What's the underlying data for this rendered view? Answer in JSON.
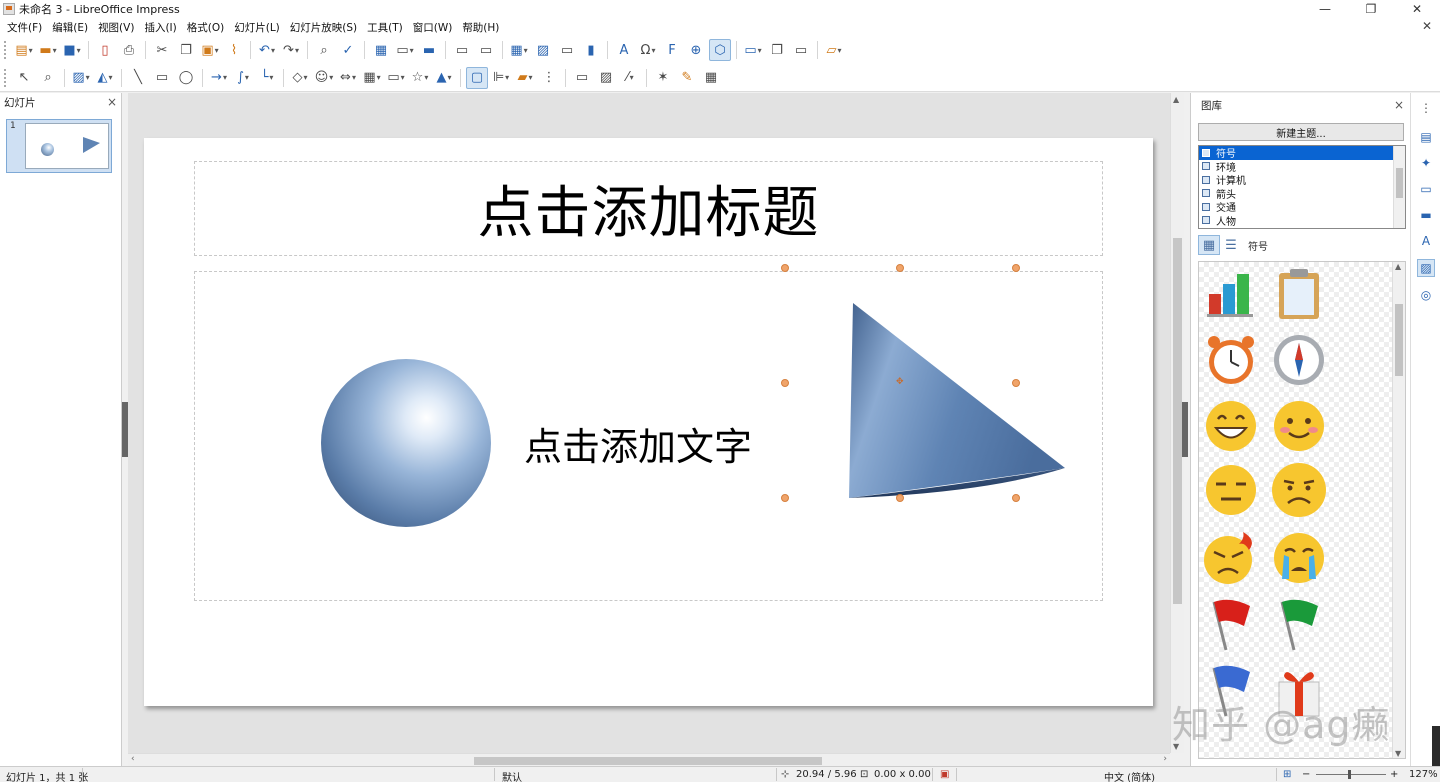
{
  "window": {
    "title": "未命名 3 - LibreOffice Impress",
    "minimize": "—",
    "restore": "❐",
    "close": "✕"
  },
  "menu": [
    "文件(F)",
    "编辑(E)",
    "视图(V)",
    "插入(I)",
    "格式(O)",
    "幻灯片(L)",
    "幻灯片放映(S)",
    "工具(T)",
    "窗口(W)",
    "帮助(H)"
  ],
  "slide_pane": {
    "title": "幻灯片",
    "close": "×",
    "thumb_number": "1"
  },
  "slide": {
    "title": "点击添加标题",
    "content": "点击添加文字"
  },
  "gallery": {
    "title": "图库",
    "close": "×",
    "new_theme": "新建主题...",
    "themes": [
      "符号",
      "环境",
      "计算机",
      "箭头",
      "交通",
      "人物"
    ],
    "selected_theme": "符号",
    "current_label": "符号"
  },
  "statusbar": {
    "slide_info": "幻灯片 1，共 1 张",
    "layout": "默认",
    "position": "20.94 / 5.96",
    "size": "0.00 x 0.00",
    "language": "中文 (简体)",
    "zoom": "127%"
  },
  "watermark": "知乎 @ag癞",
  "colors": {
    "accent": "#0a64d2",
    "shape_blue": "#5f84b4",
    "handle": "#f0a46a"
  },
  "icons": {
    "gallery_items": [
      "bar-chart-icon",
      "clipboard-icon",
      "alarm-clock-icon",
      "compass-icon",
      "grinning-face-icon",
      "smiling-face-icon",
      "unamused-face-icon",
      "frowning-face-icon",
      "angry-face-icon",
      "crying-face-icon",
      "red-flag-icon",
      "green-flag-icon",
      "blue-flag-icon",
      "gift-icon"
    ]
  }
}
